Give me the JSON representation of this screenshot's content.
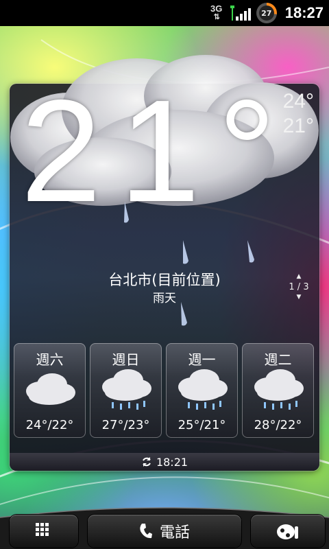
{
  "status_bar": {
    "network": "3G",
    "battery_level": "27",
    "time": "18:27"
  },
  "weather": {
    "current_temp": "21°",
    "high": "24°",
    "low": "21°",
    "location": "台北市(目前位置)",
    "condition": "雨天",
    "page_indicator": "1 / 3",
    "forecast": [
      {
        "day": "週六",
        "temps": "24°/22°",
        "icon": "cloudy-icon"
      },
      {
        "day": "週日",
        "temps": "27°/23°",
        "icon": "rain-icon"
      },
      {
        "day": "週一",
        "temps": "25°/21°",
        "icon": "rain-icon"
      },
      {
        "day": "週二",
        "temps": "28°/22°",
        "icon": "rain-icon"
      }
    ],
    "last_updated": "18:21"
  },
  "dock": {
    "phone_label": "電話",
    "apps_icon": "grid-icon",
    "personalize_icon": "personalize-icon"
  }
}
